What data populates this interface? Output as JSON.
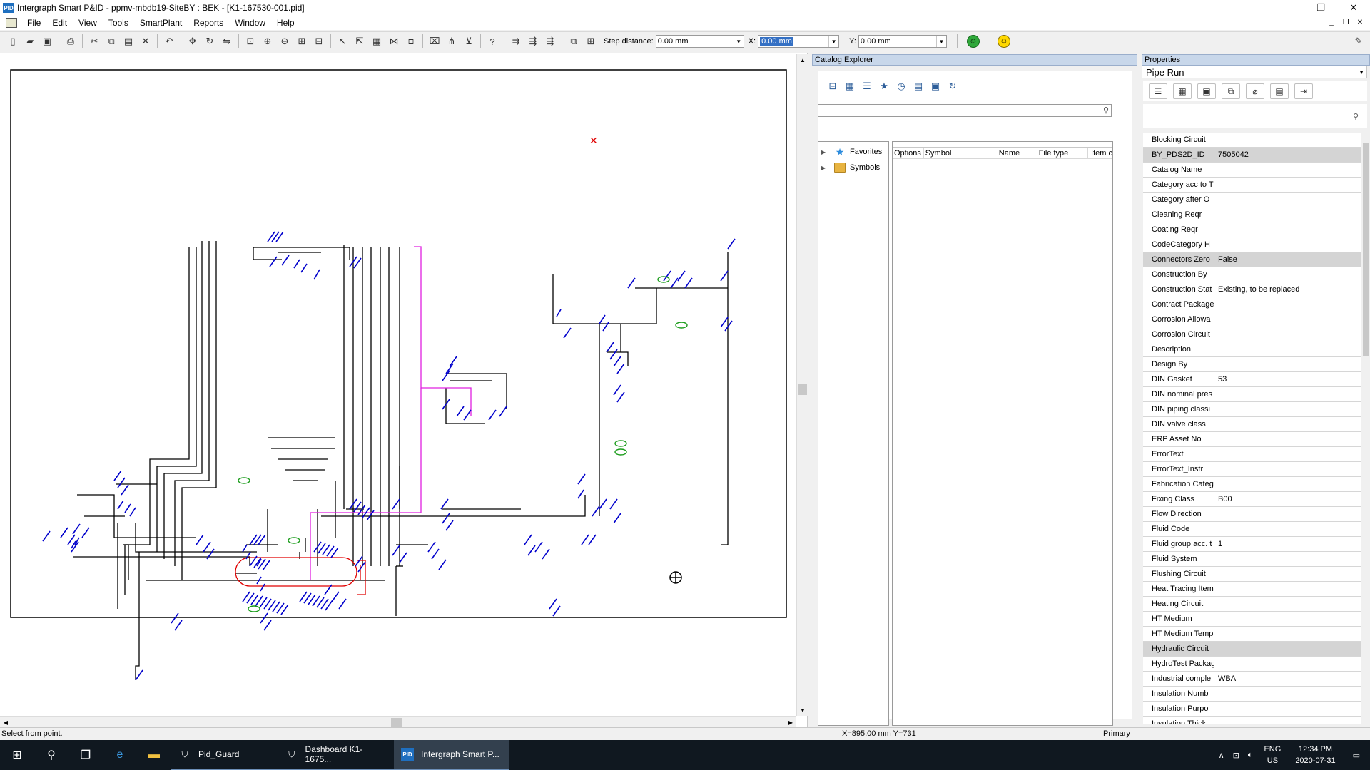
{
  "window": {
    "app_icon_label": "PID",
    "title": "Intergraph Smart P&ID - ppmv-mbdb19-SiteBY : BEK - [K1-167530-001.pid]",
    "minimize": "—",
    "maximize": "❐",
    "close": "✕"
  },
  "menu": {
    "items": [
      "File",
      "Edit",
      "View",
      "Tools",
      "SmartPlant",
      "Reports",
      "Window",
      "Help"
    ]
  },
  "toolbar": {
    "step_distance_label": "Step distance:",
    "step_distance_value": "0.00 mm",
    "x_label": "X:",
    "x_value": "0.00 mm",
    "y_label": "Y:",
    "y_value": "0.00 mm",
    "status_ok_icon": "green-status-icon",
    "smile_icon": "smiley-icon"
  },
  "catalog": {
    "title": "Catalog Explorer",
    "tree": [
      {
        "label": "Favorites",
        "icon": "star-icon"
      },
      {
        "label": "Symbols",
        "icon": "folder-icon"
      }
    ],
    "columns": [
      "Options",
      "Symbol",
      "Name",
      "File type",
      "Item c"
    ]
  },
  "properties": {
    "title": "Properties",
    "item_type": "Pipe Run",
    "rows": [
      {
        "name": "Blocking Circuit",
        "value": ""
      },
      {
        "name": "BY_PDS2D_ID",
        "value": "7505042",
        "highlight": true
      },
      {
        "name": "Catalog Name",
        "value": ""
      },
      {
        "name": "Category acc to T",
        "value": ""
      },
      {
        "name": "Category after O",
        "value": ""
      },
      {
        "name": "Cleaning Reqr",
        "value": ""
      },
      {
        "name": "Coating Reqr",
        "value": ""
      },
      {
        "name": "CodeCategory H",
        "value": ""
      },
      {
        "name": "Connectors Zero",
        "value": "False",
        "highlight": true
      },
      {
        "name": "Construction By",
        "value": ""
      },
      {
        "name": "Construction Stat",
        "value": "Existing, to be replaced"
      },
      {
        "name": "Contract Package",
        "value": ""
      },
      {
        "name": "Corrosion Allowa",
        "value": ""
      },
      {
        "name": "Corrosion Circuit",
        "value": ""
      },
      {
        "name": "Description",
        "value": ""
      },
      {
        "name": "Design By",
        "value": ""
      },
      {
        "name": "DIN Gasket",
        "value": "53"
      },
      {
        "name": "DIN nominal pres",
        "value": ""
      },
      {
        "name": "DIN piping classi",
        "value": ""
      },
      {
        "name": "DIN valve class",
        "value": ""
      },
      {
        "name": "ERP Asset No",
        "value": ""
      },
      {
        "name": "ErrorText",
        "value": ""
      },
      {
        "name": "ErrorText_Instr",
        "value": ""
      },
      {
        "name": "Fabrication Categ",
        "value": ""
      },
      {
        "name": "Fixing Class",
        "value": "B00"
      },
      {
        "name": "Flow Direction",
        "value": ""
      },
      {
        "name": "Fluid Code",
        "value": ""
      },
      {
        "name": "Fluid group acc. t",
        "value": "1"
      },
      {
        "name": "Fluid System",
        "value": ""
      },
      {
        "name": "Flushing Circuit",
        "value": ""
      },
      {
        "name": "Heat Tracing Item",
        "value": ""
      },
      {
        "name": "Heating Circuit",
        "value": ""
      },
      {
        "name": "HT Medium",
        "value": ""
      },
      {
        "name": "HT Medium Temp",
        "value": ""
      },
      {
        "name": "Hydraulic Circuit",
        "value": "",
        "highlight": true
      },
      {
        "name": "HydroTest Packag",
        "value": ""
      },
      {
        "name": "Industrial comple",
        "value": "WBA"
      },
      {
        "name": "Insulation Numb",
        "value": ""
      },
      {
        "name": "Insulation Purpo",
        "value": ""
      },
      {
        "name": "Insulation Thick",
        "value": ""
      }
    ]
  },
  "status": {
    "message": "Select from point.",
    "coords": "X=895.00 mm   Y=731",
    "layer": "Primary"
  },
  "taskbar": {
    "apps": [
      {
        "label": "Pid_Guard",
        "icon": "shield-icon"
      },
      {
        "label": "Dashboard K1-1675...",
        "icon": "shield-icon"
      },
      {
        "label": "Intergraph Smart P...",
        "icon": "pid-app-icon",
        "active": true
      }
    ],
    "lang_top": "ENG",
    "lang_bottom": "US",
    "time": "12:34 PM",
    "date": "2020-07-31"
  }
}
